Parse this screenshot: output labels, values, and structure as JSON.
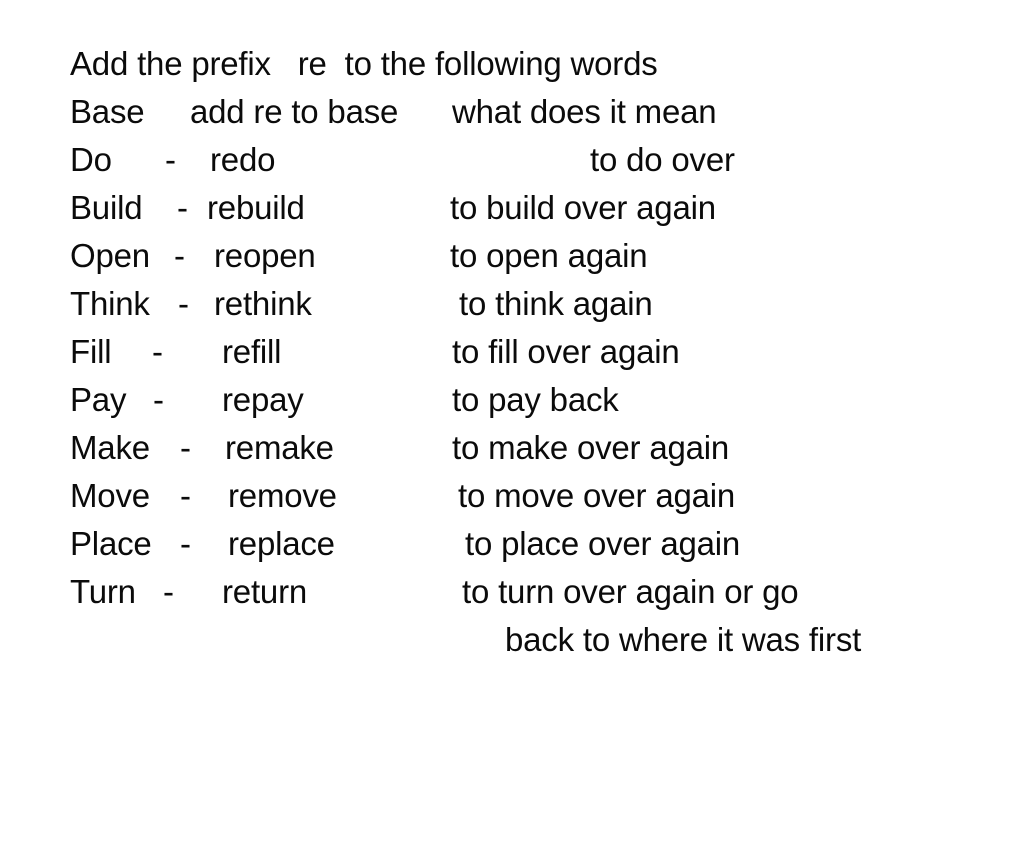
{
  "slide": {
    "background_color": "#ffffff",
    "text_color": "#0b0b0b",
    "instruction": "Add the prefix   re  to the following words",
    "column_headers": {
      "base": "Base",
      "prefixed": "add re to base",
      "meaning": "what does it mean"
    },
    "rows": [
      {
        "base": "Do",
        "dash": "-",
        "prefixed": "redo",
        "meaning": "to do over"
      },
      {
        "base": "Build",
        "dash": "-",
        "prefixed": "rebuild",
        "meaning": "to build over again"
      },
      {
        "base": "Open",
        "dash": "-",
        "prefixed": "reopen",
        "meaning": "to open again"
      },
      {
        "base": "Think",
        "dash": "-",
        "prefixed": "rethink",
        "meaning": "to think again"
      },
      {
        "base": "Fill",
        "dash": "-",
        "prefixed": "refill",
        "meaning": "to fill over again"
      },
      {
        "base": "Pay",
        "dash": "-",
        "prefixed": "repay",
        "meaning": "to pay back"
      },
      {
        "base": "Make",
        "dash": "-",
        "prefixed": "remake",
        "meaning": "to make over again"
      },
      {
        "base": "Move",
        "dash": "-",
        "prefixed": "remove",
        "meaning": "to move over again"
      },
      {
        "base": "Place",
        "dash": "-",
        "prefixed": "replace",
        "meaning": "to place over again"
      },
      {
        "base": "Turn",
        "dash": "-",
        "prefixed": "return",
        "meaning": "to turn over again or go"
      }
    ],
    "continuation_line": "back to where it was first"
  }
}
